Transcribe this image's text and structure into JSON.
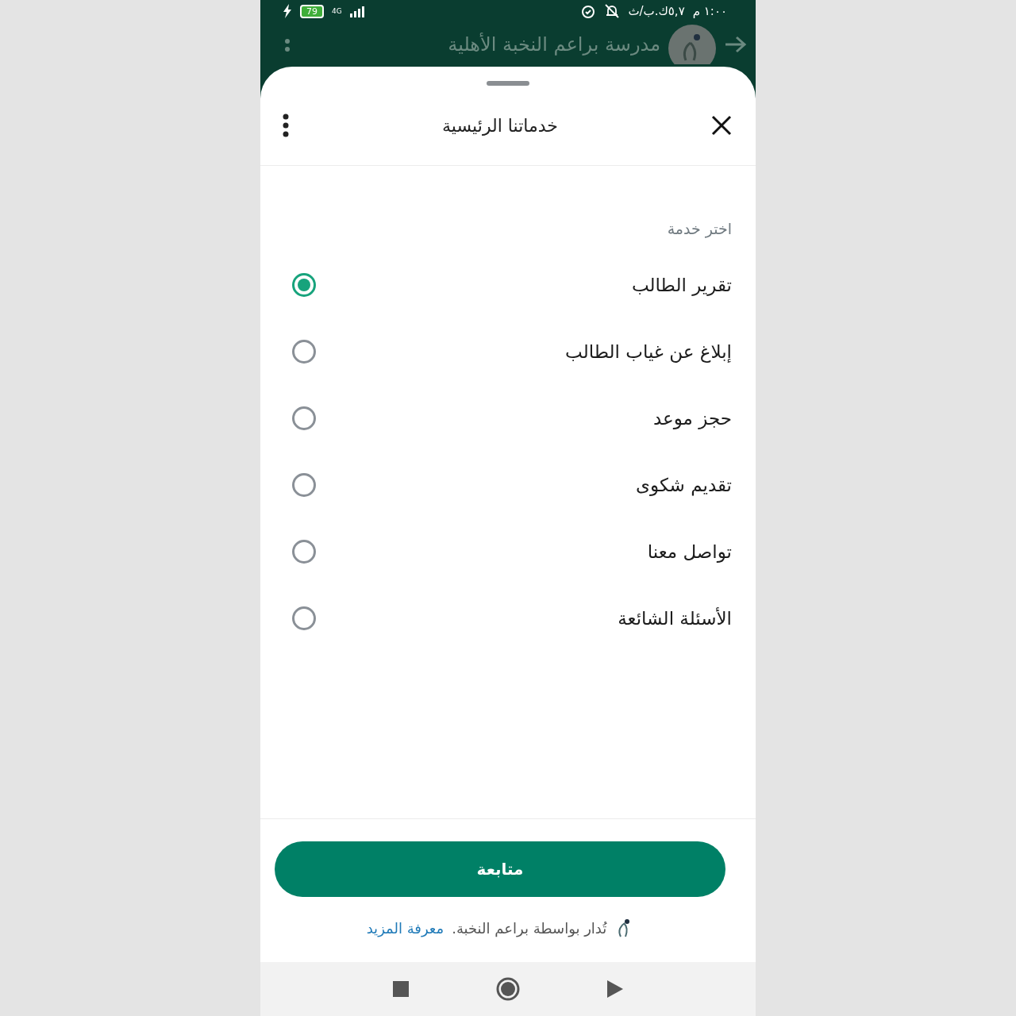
{
  "status_bar": {
    "time": "١:٠٠ م",
    "speed": "٥,٧ك.ب/ث",
    "battery": "79",
    "network": "4G"
  },
  "header": {
    "title": "مدرسة براعم النخبة الأهلية"
  },
  "sheet": {
    "title": "خدماتنا الرئيسية",
    "prompt": "اختر خدمة",
    "options": [
      {
        "label": "تقرير الطالب",
        "selected": true
      },
      {
        "label": "إبلاغ عن غياب الطالب",
        "selected": false
      },
      {
        "label": "حجز موعد",
        "selected": false
      },
      {
        "label": "تقديم شكوى",
        "selected": false
      },
      {
        "label": "تواصل معنا",
        "selected": false
      },
      {
        "label": "الأسئلة الشائعة",
        "selected": false
      }
    ],
    "button": "متابعة",
    "footer": {
      "text": "تُدار بواسطة براعم النخبة.",
      "link": "معرفة المزيد"
    }
  }
}
